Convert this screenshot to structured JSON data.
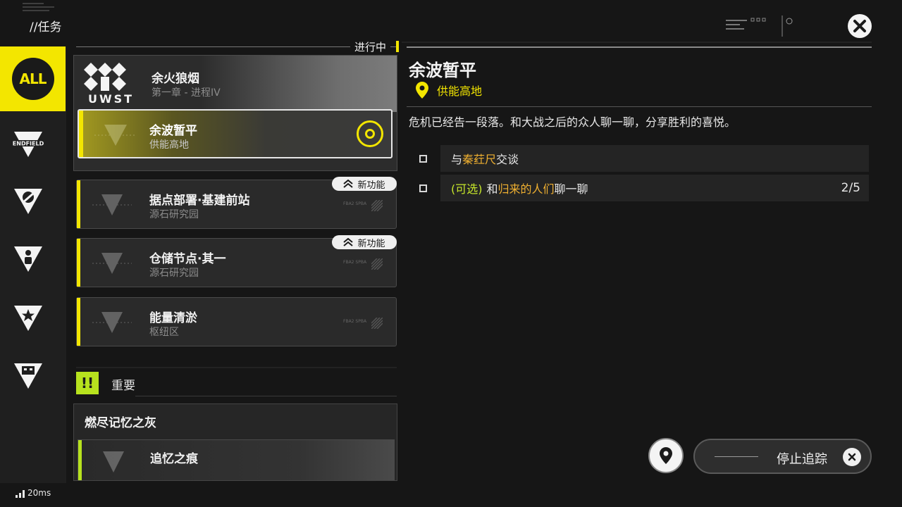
{
  "header": {
    "title": "//任务"
  },
  "rail": {
    "items": [
      {
        "label": "ALL",
        "icon": "all-badge-icon"
      },
      {
        "label": "ENDFIELD",
        "icon": "endfield-icon"
      },
      {
        "label": "",
        "icon": "leaf-icon"
      },
      {
        "label": "",
        "icon": "person-icon"
      },
      {
        "label": "",
        "icon": "star-icon"
      },
      {
        "label": "",
        "icon": "building-icon"
      }
    ]
  },
  "list": {
    "status_label": "进行中",
    "chapter": {
      "logo_text": "UWST",
      "name": "余火狼烟",
      "progress": "第一章 - 进程IV"
    },
    "active_quest": {
      "title": "余波暂平",
      "location": "供能高地"
    },
    "quests": [
      {
        "title": "据点部署·基建前站",
        "location": "源石研究园",
        "badge": "新功能",
        "tag": "FBA2 SPBA"
      },
      {
        "title": "仓储节点·其一",
        "location": "源石研究园",
        "badge": "新功能",
        "tag": "FBA2 SPBA"
      },
      {
        "title": "能量清淤",
        "location": "枢纽区",
        "badge": "",
        "tag": "FBA2 SPBA"
      }
    ],
    "important": {
      "icon": "!!",
      "label": "重要",
      "chapter_name": "燃尽记忆之灰",
      "quest_title": "追忆之痕"
    }
  },
  "detail": {
    "title": "余波暂平",
    "location": "供能高地",
    "description": "危机已经告一段落。和大战之后的众人聊一聊，分享胜利的喜悦。",
    "objectives": [
      {
        "prefix": "与",
        "highlight": "秦荭尺",
        "suffix": "交谈",
        "optional": "",
        "count": ""
      },
      {
        "prefix": "和",
        "highlight": "归来的人们",
        "suffix": "聊一聊",
        "optional": "(可选)",
        "count": "2/5"
      }
    ]
  },
  "footer": {
    "latency": "20ms",
    "stop_tracking": "停止追踪"
  },
  "colors": {
    "accent": "#f3e600",
    "highlight": "#f0b030",
    "optional": "#c6e62a",
    "important": "#b7e21e"
  }
}
